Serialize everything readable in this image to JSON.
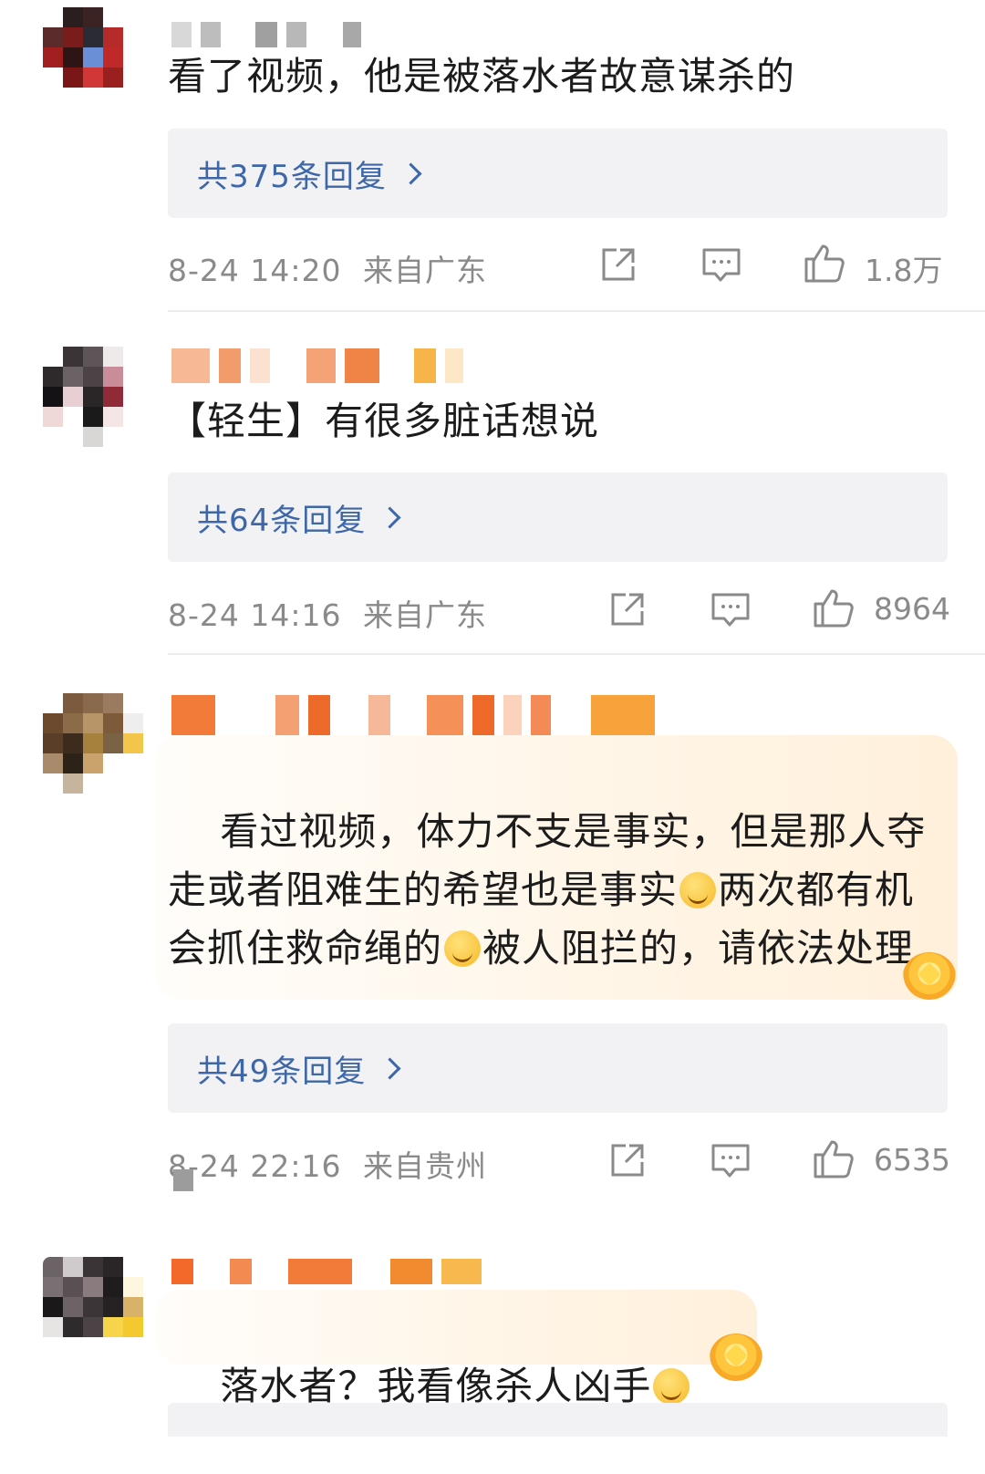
{
  "comments": [
    {
      "text": "看了视频，他是被落水者故意谋杀的",
      "reply_label": "共375条回复",
      "time": "8-24 14:20",
      "location": "来自广东",
      "likes": "1.8万"
    },
    {
      "text": "【轻生】有很多脏话想说",
      "reply_label": "共64条回复",
      "time": "8-24 14:16",
      "location": "来自广东",
      "likes": "8964"
    },
    {
      "text_a": "看过视频，体力不支是事实，但是那人夺走或者阻难生的希望也是事实",
      "text_b": "两次都有机会抓住救命绳的",
      "text_c": "被人阻拦的，请依法处理",
      "reply_label": "共49条回复",
      "time": "8-24 22:16",
      "location": "来自贵州",
      "likes": "6535"
    },
    {
      "text": "落水者？我看像杀人凶手"
    }
  ],
  "icons": {
    "share": "share-icon",
    "comment": "comment-icon",
    "like": "thumbs-up-icon",
    "chevron": "chevron-right-icon"
  },
  "colors": {
    "link_blue": "#3d67a8",
    "meta_gray": "#8a8a8a",
    "reply_bg": "#f2f2f4"
  }
}
